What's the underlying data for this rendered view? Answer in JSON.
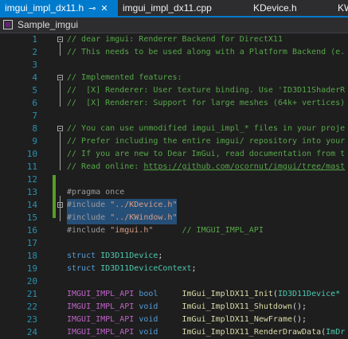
{
  "tabs": [
    {
      "label": "imgui_impl_dx11.h",
      "active": true,
      "pin": "⊸",
      "close": "✕"
    },
    {
      "label": "imgui_impl_dx11.cpp",
      "active": false
    },
    {
      "label": "KDevice.h",
      "active": false
    },
    {
      "label": "KW",
      "active": false
    }
  ],
  "navbar": {
    "project": "Sample_imgui"
  },
  "lines": {
    "n1": "1",
    "n2": "2",
    "n3": "3",
    "n4": "4",
    "n5": "5",
    "n6": "6",
    "n7": "7",
    "n8": "8",
    "n9": "9",
    "n10": "10",
    "n11": "11",
    "n12": "12",
    "n13": "13",
    "n14": "14",
    "n15": "15",
    "n16": "16",
    "n17": "17",
    "n18": "18",
    "n19": "19",
    "n20": "20",
    "n21": "21",
    "n22": "22",
    "n23": "23",
    "n24": "24",
    "l1": "// dear imgui: Renderer Backend for DirectX11",
    "l2": "// This needs to be used along with a Platform Backend (e.",
    "l4": "// Implemented features:",
    "l5": "//  [X] Renderer: User texture binding. Use 'ID3D11ShaderR",
    "l6": "//  [X] Renderer: Support for large meshes (64k+ vertices)",
    "l8": "// You can use unmodified imgui_impl_* files in your proje",
    "l9": "// Prefer including the entire imgui/ repository into your",
    "l10": "// If you are new to Dear ImGui, read documentation from t",
    "l11a": "// Read online: ",
    "l11b": "https://github.com/ocornut/imgui/tree/mast",
    "l13": "#pragma once",
    "l14a": "#include ",
    "l14b": "\"../KDevice.h\"",
    "l15a": "#include ",
    "l15b": "\"../KWindow.h\"",
    "l16a": "#include ",
    "l16b": "\"imgui.h\"",
    "l16c": "      // IMGUI_IMPL_API",
    "l18a": "struct ",
    "l18b": "ID3D11Device",
    "l18c": ";",
    "l19a": "struct ",
    "l19b": "ID3D11DeviceContext",
    "l19c": ";",
    "l21a": "IMGUI_IMPL_API",
    "l21b": " bool     ",
    "l21c": "ImGui_ImplDX11_Init",
    "l21d": "(",
    "l21e": "ID3D11Device*",
    "l22a": "IMGUI_IMPL_API",
    "l22b": " void     ",
    "l22c": "ImGui_ImplDX11_Shutdown",
    "l22d": "();",
    "l23a": "IMGUI_IMPL_API",
    "l23b": " void     ",
    "l23c": "ImGui_ImplDX11_NewFrame",
    "l23d": "();",
    "l24a": "IMGUI_IMPL_API",
    "l24b": " void     ",
    "l24c": "ImGui_ImplDX11_RenderDrawData",
    "l24d": "(",
    "l24e": "ImDr"
  },
  "colors": {
    "accent": "#007acc",
    "comment": "#57a64a",
    "line_number": "#2b91af",
    "keyword": "#569cd6",
    "type": "#4ec9b0",
    "string": "#d69d85",
    "macro": "#bd63c5",
    "selection": "#264f78",
    "change_bar": "#579c2b"
  }
}
